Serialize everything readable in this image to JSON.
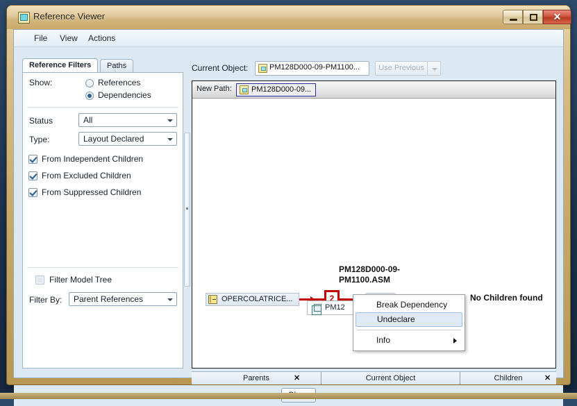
{
  "window": {
    "title": "Reference Viewer",
    "icon": "app-window-icon",
    "controls": {
      "minimize": "–",
      "maximize": "□",
      "close": "✕"
    }
  },
  "menubar": {
    "items": [
      "File",
      "View",
      "Actions"
    ]
  },
  "left_panel": {
    "tabs": [
      {
        "label": "Reference Filters",
        "selected": true
      },
      {
        "label": "Paths",
        "selected": false
      }
    ],
    "show_label": "Show:",
    "show_options": [
      {
        "label": "References",
        "selected": false
      },
      {
        "label": "Dependencies",
        "selected": true
      }
    ],
    "status_label": "Status",
    "status_value": "All",
    "type_label": "Type:",
    "type_value": "Layout Declared",
    "checkboxes": [
      {
        "label": "From Independent Children",
        "checked": true
      },
      {
        "label": "From Excluded Children",
        "checked": true
      },
      {
        "label": "From Suppressed Children",
        "checked": true
      }
    ],
    "filter_model_tree": {
      "label": "Filter Model Tree",
      "checked": false,
      "enabled": false
    },
    "filter_by_label": "Filter By:",
    "filter_by_value": "Parent References"
  },
  "toolbar": {
    "current_object_label": "Current Object:",
    "current_object_value": "PM128D000-09-PM1100...",
    "use_previous_label": "Use Previous"
  },
  "graph": {
    "path_label": "New Path:",
    "path_chip": "PM128D000-09...",
    "left_node": "OPERCOLATRICE...",
    "sub_node": "PM12",
    "edge_count": "2",
    "right_node_label": "PM128D000-09-PM1100.ASM",
    "no_children": "No Children found"
  },
  "context_menu": {
    "items": [
      {
        "label": "Break Dependency",
        "highlighted": false,
        "submenu": false
      },
      {
        "label": "Undeclare",
        "highlighted": true,
        "submenu": false
      },
      {
        "separator": true
      },
      {
        "label": "Info",
        "highlighted": false,
        "submenu": true
      }
    ]
  },
  "bottom_bar": {
    "panes": [
      {
        "label": "Parents",
        "close": "✕"
      },
      {
        "label": "Current Object",
        "close": ""
      },
      {
        "label": "Children",
        "close": "✕"
      }
    ]
  },
  "footer": {
    "close_label": "Close"
  },
  "colors": {
    "frame": "#c9a968",
    "edge_red": "#c00000",
    "highlight": "#dfeaf4",
    "desktop": "#1d3350"
  }
}
